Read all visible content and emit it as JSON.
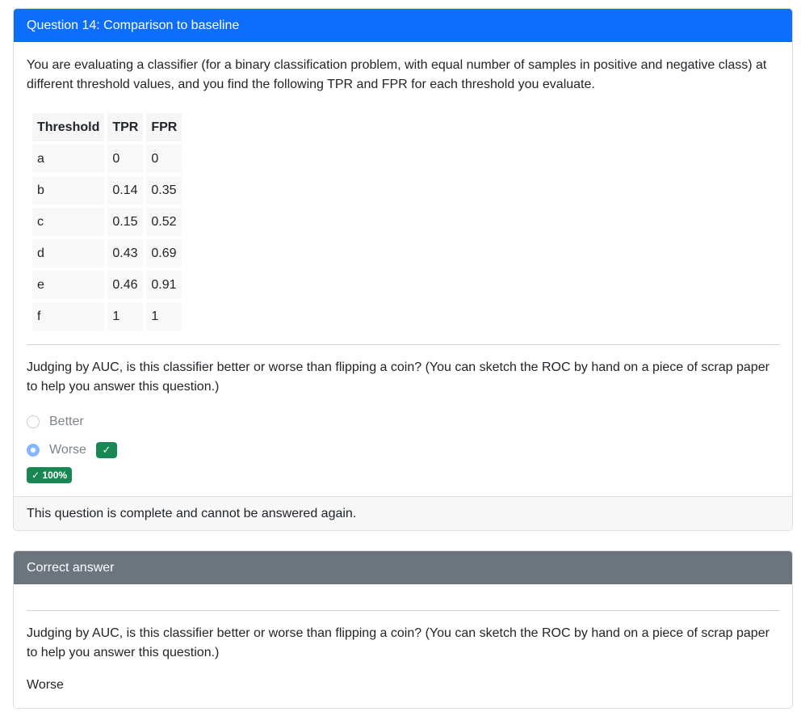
{
  "question": {
    "title": "Question 14: Comparison to baseline",
    "intro": "You are evaluating a classifier (for a binary classification problem, with equal number of samples in positive and negative class) at different threshold values, and you find the following TPR and FPR for each threshold you evaluate.",
    "table": {
      "headers": [
        "Threshold",
        "TPR",
        "FPR"
      ],
      "rows": [
        [
          "a",
          "0",
          "0"
        ],
        [
          "b",
          "0.14",
          "0.35"
        ],
        [
          "c",
          "0.15",
          "0.52"
        ],
        [
          "d",
          "0.43",
          "0.69"
        ],
        [
          "e",
          "0.46",
          "0.91"
        ],
        [
          "f",
          "1",
          "1"
        ]
      ]
    },
    "prompt": "Judging by AUC, is this classifier better or worse than flipping a coin? (You can sketch the ROC by hand on a piece of scrap paper to help you answer this question.)",
    "options": [
      {
        "label": "Better",
        "selected": false
      },
      {
        "label": "Worse",
        "selected": true
      }
    ],
    "correct_icon": "check-icon",
    "score_badge": "✓ 100%",
    "footer": "This question is complete and cannot be answered again."
  },
  "correct_answer": {
    "title": "Correct answer",
    "prompt": "Judging by AUC, is this classifier better or worse than flipping a coin? (You can sketch the ROC by hand on a piece of scrap paper to help you answer this question.)",
    "answer": "Worse"
  },
  "colors": {
    "primary": "#0d6efd",
    "secondary": "#6c757d",
    "success": "#198754"
  }
}
